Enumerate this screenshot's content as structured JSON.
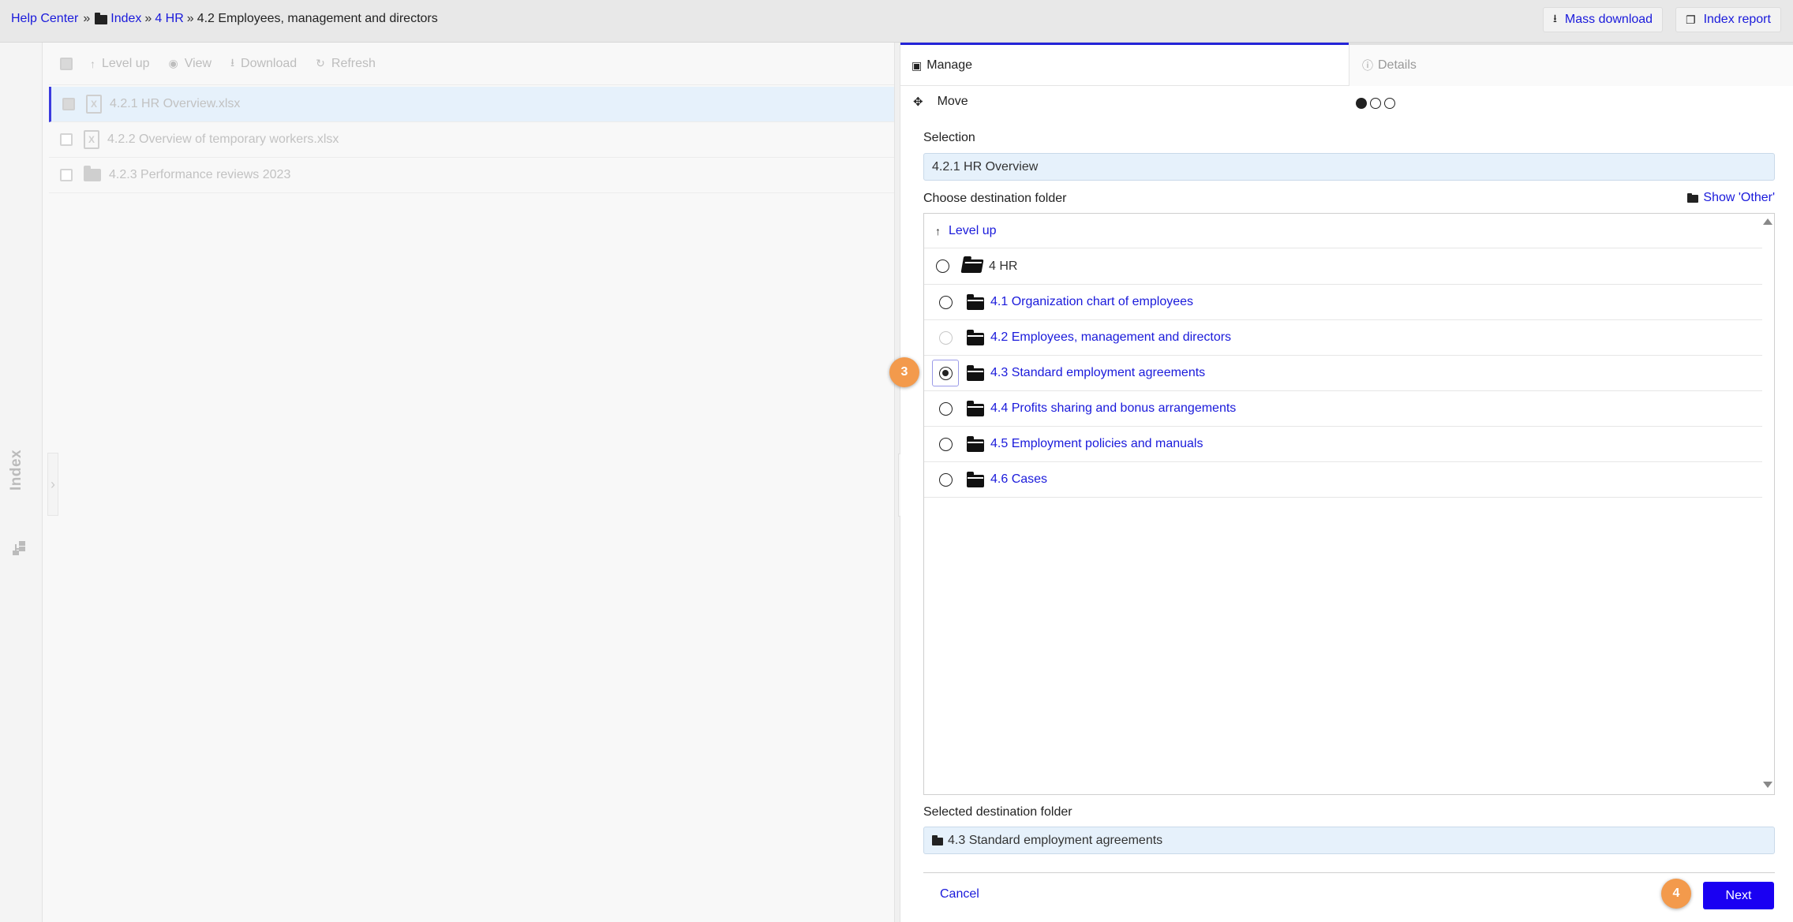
{
  "breadcrumb": {
    "root": "Help Center",
    "sep": "»",
    "items": [
      "Index",
      "4 HR"
    ],
    "current": "4.2 Employees, management and directors"
  },
  "top_actions": {
    "mass_download": "Mass download",
    "index_report": "Index report"
  },
  "index_sidebar": {
    "label": "Index"
  },
  "toolbar": {
    "level_up": "Level up",
    "view": "View",
    "download": "Download",
    "refresh": "Refresh"
  },
  "files": [
    {
      "name": "4.2.1 HR Overview.xlsx",
      "type": "xlsx",
      "selected": true
    },
    {
      "name": "4.2.2 Overview of temporary workers.xlsx",
      "type": "xlsx",
      "selected": false
    },
    {
      "name": "4.2.3 Performance reviews 2023",
      "type": "folder",
      "selected": false
    }
  ],
  "tabs": {
    "manage": "Manage",
    "details": "Details"
  },
  "action": {
    "label": "Move",
    "step_current": 1,
    "step_total": 3
  },
  "selection": {
    "label": "Selection",
    "value": "4.2.1 HR Overview"
  },
  "destination": {
    "label": "Choose destination folder",
    "show_other": "Show 'Other'",
    "level_up": "Level up",
    "parent": "4 HR",
    "folders": [
      {
        "name": "4.1 Organization chart of employees",
        "state": "unselected"
      },
      {
        "name": "4.2 Employees, management and directors",
        "state": "disabled"
      },
      {
        "name": "4.3 Standard employment agreements",
        "state": "selected"
      },
      {
        "name": "4.4 Profits sharing and bonus arrangements",
        "state": "unselected"
      },
      {
        "name": "4.5 Employment policies and manuals",
        "state": "unselected"
      },
      {
        "name": "4.6 Cases",
        "state": "unselected"
      }
    ]
  },
  "selected_destination": {
    "label": "Selected destination folder",
    "value": "4.3 Standard employment agreements"
  },
  "buttons": {
    "cancel": "Cancel",
    "next": "Next"
  },
  "step_markers": [
    "3",
    "4"
  ],
  "colors": {
    "accent": "#1a00f2",
    "link": "#1a1adb",
    "marker": "#f39a4c",
    "field_bg": "#e6f1fb"
  }
}
